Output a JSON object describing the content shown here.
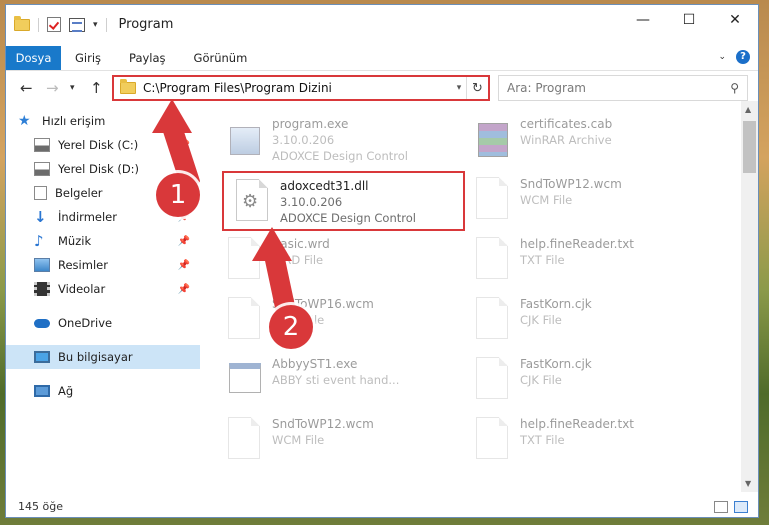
{
  "window": {
    "title": "Program",
    "controls": [
      "minimize-icon",
      "maximize-icon",
      "close-icon"
    ]
  },
  "ribbon": {
    "tabs": [
      "Dosya",
      "Giriş",
      "Paylaş",
      "Görünüm"
    ],
    "accent": "#1979ca"
  },
  "address": {
    "path": "C:\\Program Files\\Program Dizini"
  },
  "search": {
    "placeholder": "Ara: Program"
  },
  "sidebar": {
    "quick_access": "Hızlı erişim",
    "items": [
      {
        "label": "Yerel Disk (C:)",
        "icon": "drive-icon",
        "pinned": true
      },
      {
        "label": "Yerel Disk (D:)",
        "icon": "drive-icon",
        "pinned": true
      },
      {
        "label": "Belgeler",
        "icon": "documents-icon",
        "pinned": true
      },
      {
        "label": "İndirmeler",
        "icon": "downloads-icon",
        "pinned": true
      },
      {
        "label": "Müzik",
        "icon": "music-icon",
        "pinned": true
      },
      {
        "label": "Resimler",
        "icon": "pictures-icon",
        "pinned": true
      },
      {
        "label": "Videolar",
        "icon": "videos-icon",
        "pinned": true
      }
    ],
    "onedrive": "OneDrive",
    "this_pc": "Bu bilgisayar",
    "network": "Ağ"
  },
  "files": [
    {
      "name": "program.exe",
      "line2": "3.10.0.206",
      "line3": "ADOXCE Design Control",
      "icon": "setup-icon"
    },
    {
      "name": "certificates.cab",
      "line2": "WinRAR Archive",
      "line3": "",
      "icon": "winrar-icon"
    },
    {
      "name": "adoxcedt31.dll",
      "line2": "3.10.0.206",
      "line3": "ADOXCE Design Control",
      "icon": "dll-gear-icon"
    },
    {
      "name": "SndToWP12.wcm",
      "line2": "WCM File",
      "line3": "",
      "icon": "file-icon"
    },
    {
      "name": "Basic.wrd",
      "line2": "WRD File",
      "line3": "",
      "icon": "file-icon"
    },
    {
      "name": "help.fineReader.txt",
      "line2": "TXT File",
      "line3": "",
      "icon": "file-icon"
    },
    {
      "name": "SndToWP16.wcm",
      "line2": "WCM File",
      "line3": "",
      "icon": "file-icon"
    },
    {
      "name": "FastKorn.cjk",
      "line2": "CJK File",
      "line3": "",
      "icon": "file-icon"
    },
    {
      "name": "AbbyyST1.exe",
      "line2": "ABBY sti event hand...",
      "line3": "",
      "icon": "app-window-icon"
    },
    {
      "name": "FastKorn.cjk",
      "line2": "CJK File",
      "line3": "",
      "icon": "file-icon"
    },
    {
      "name": "SndToWP12.wcm",
      "line2": "WCM File",
      "line3": "",
      "icon": "file-icon"
    },
    {
      "name": "help.fineReader.txt",
      "line2": "TXT File",
      "line3": "",
      "icon": "file-icon"
    }
  ],
  "status": {
    "count": "145 öğe"
  },
  "annotations": {
    "step1": "1",
    "step2": "2",
    "color": "#d9383a"
  }
}
